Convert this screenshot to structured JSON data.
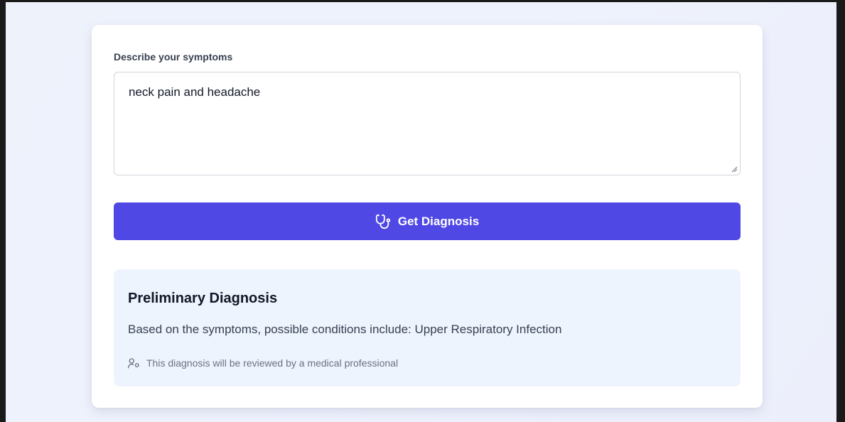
{
  "form": {
    "label": "Describe your symptoms",
    "symptoms_value": "neck pain and headache"
  },
  "button": {
    "label": "Get Diagnosis",
    "icon": "stethoscope-icon",
    "color": "#5048e5"
  },
  "result": {
    "title": "Preliminary Diagnosis",
    "body": "Based on the symptoms, possible conditions include: Upper Respiratory Infection",
    "note": "This diagnosis will be reviewed by a medical professional",
    "note_icon": "user-cog-icon",
    "background": "#eef4fe"
  }
}
